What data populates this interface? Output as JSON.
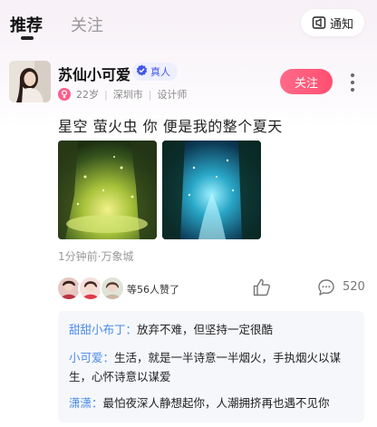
{
  "tabs": [
    {
      "label": "推荐",
      "active": true
    },
    {
      "label": "关注",
      "active": false
    }
  ],
  "notify": {
    "label": "通知",
    "icon": "speaker-icon"
  },
  "post": {
    "username": "苏仙小可爱",
    "verified_label": "真人",
    "age": "22岁",
    "city": "深圳市",
    "job": "设计师",
    "follow_label": "关注",
    "text": "星空 萤火虫 你 便是我的整个夏天",
    "time_location": "1分钟前·万象城",
    "likes_text": "等56人赞了",
    "comment_count": "520",
    "comments": [
      {
        "author": "甜甜小布丁：",
        "text": "放弃不难，但坚持一定很酷"
      },
      {
        "author": "小可爱：",
        "text": "生活，就是一半诗意一半烟火，手执烟火以谋生，心怀诗意以谋爱"
      },
      {
        "author": "潇潇：",
        "text": "最怕夜深人静想起你，人潮拥挤再也遇不见你"
      }
    ]
  },
  "colors": {
    "accent_pink": "#ff5573",
    "verified_blue": "#4457e6",
    "comment_author_blue": "#4a8be8"
  }
}
